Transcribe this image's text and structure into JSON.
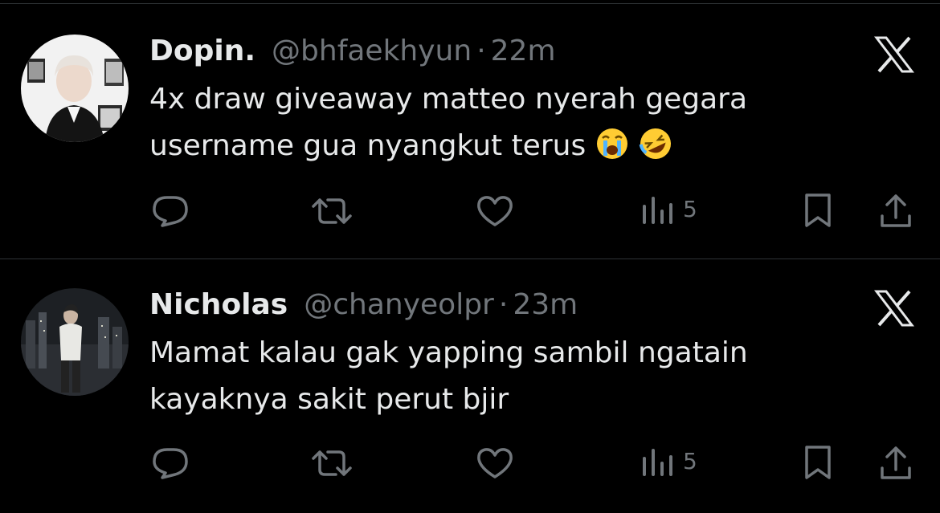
{
  "colors": {
    "background": "#000000",
    "text_primary": "#e7e9ea",
    "text_secondary": "#71767b",
    "divider": "#2f3336"
  },
  "tweets": [
    {
      "display_name": "Dopin.",
      "handle": "@bhfaekhyun",
      "separator": "·",
      "time": "22m",
      "text": "4x draw giveaway matteo nyerah gegara username gua nyangkut terus",
      "emojis": [
        "loudly-crying-face",
        "rolling-on-the-floor-laughing"
      ],
      "views": "5",
      "icons": [
        "reply-icon",
        "retweet-icon",
        "like-icon",
        "views-icon",
        "bookmark-icon",
        "share-icon"
      ]
    },
    {
      "display_name": "Nicholas",
      "handle": "@chanyeolpr",
      "separator": "·",
      "time": "23m",
      "text": "Mamat kalau gak yapping sambil ngatain kayaknya sakit perut bjir",
      "emojis": [],
      "views": "5",
      "icons": [
        "reply-icon",
        "retweet-icon",
        "like-icon",
        "views-icon",
        "bookmark-icon",
        "share-icon"
      ]
    }
  ]
}
